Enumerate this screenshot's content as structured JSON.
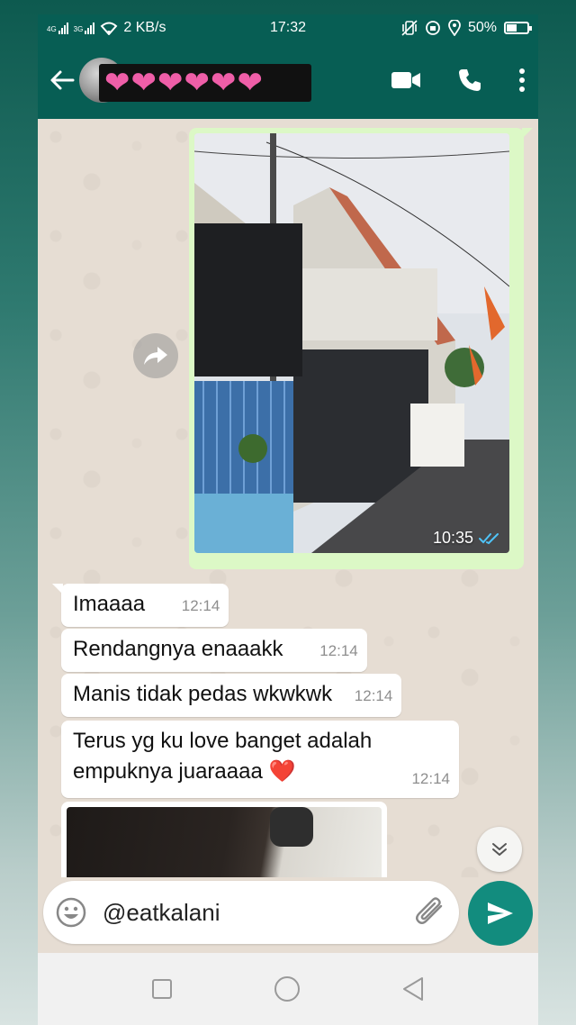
{
  "status_bar": {
    "network_left": "4G",
    "network_right": "3G",
    "speed": "2 KB/s",
    "time": "17:32",
    "battery_percent": "50%",
    "battery_level": 0.5
  },
  "header": {
    "contact_name": "❤❤❤❤❤❤"
  },
  "messages": {
    "image_time": "10:35",
    "m1": {
      "text": "Imaaaa",
      "time": "12:14"
    },
    "m2": {
      "text": "Rendangnya enaaakk",
      "time": "12:14"
    },
    "m3": {
      "text": "Manis tidak pedas wkwkwk",
      "time": "12:14"
    },
    "m4": {
      "line1": "Terus yg ku love banget adalah",
      "line2": "empuknya juaraaaa ❤️",
      "time": "12:14"
    }
  },
  "composer": {
    "value": "@eatkalani"
  },
  "colors": {
    "header": "#075e54",
    "outgoing_bubble": "#dcf8c6",
    "incoming_bubble": "#ffffff",
    "send_button": "#128c7e",
    "read_ticks": "#4fc3f7"
  },
  "icons": [
    "back-arrow-icon",
    "video-call-icon",
    "phone-icon",
    "more-vert-icon",
    "forward-icon",
    "double-check-icon",
    "chevron-double-down-icon",
    "emoji-icon",
    "attach-icon",
    "send-icon",
    "nav-square-icon",
    "nav-circle-icon",
    "nav-triangle-icon",
    "wifi-icon",
    "vibrate-icon",
    "alarm-icon",
    "location-icon",
    "battery-icon"
  ]
}
